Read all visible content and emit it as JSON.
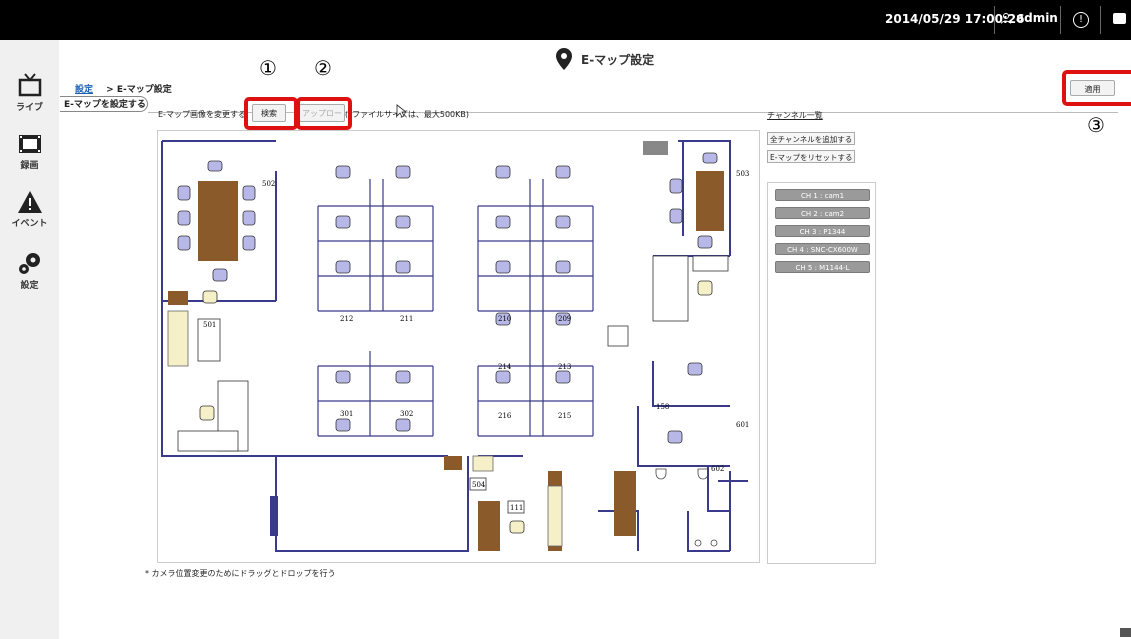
{
  "topbar": {
    "datetime": "2014/05/29 17:00:26",
    "user": "admin"
  },
  "sidebar": {
    "items": [
      {
        "label": "ライブ",
        "icon": "tv-icon"
      },
      {
        "label": "録画",
        "icon": "film-icon"
      },
      {
        "label": "イベント",
        "icon": "warning-icon"
      },
      {
        "label": "設定",
        "icon": "gears-icon"
      }
    ]
  },
  "header": {
    "title": "E-マップ設定"
  },
  "breadcrumb": {
    "link": "設定",
    "current": "> E-マップ設定"
  },
  "tab": {
    "label": "E-マップを設定する"
  },
  "emap": {
    "change_label": "E-マップ画像を変更する:",
    "browse_label": "検索",
    "upload_label": "アップロード",
    "file_note": "(*ファイルサイズは、最大500KB)"
  },
  "apply_label": "適用",
  "annotations": [
    "①",
    "②",
    "③"
  ],
  "map": {
    "note": "* カメラ位置変更のためにドラッグとドロップを行う",
    "rooms": [
      "502",
      "501",
      "212",
      "211",
      "210",
      "209",
      "214",
      "213",
      "301",
      "302",
      "216",
      "215",
      "503",
      "158",
      "601",
      "602",
      "504",
      "111"
    ]
  },
  "channels": {
    "title": "チャンネル一覧",
    "add_all": "全チャンネルを追加する",
    "reset": "E-マップをリセットする",
    "items": [
      "CH 1 : cam1",
      "CH 2 : cam2",
      "CH 3 : P1344",
      "CH 4 : SNC-CX600W",
      "CH 5 : M1144-L"
    ]
  },
  "colors": {
    "wall": "#3a3a8c",
    "desk": "#8b5a2b",
    "chair": "#b8b8e8",
    "sofa": "#f5f0c8",
    "annotation_red": "#dd1111"
  }
}
